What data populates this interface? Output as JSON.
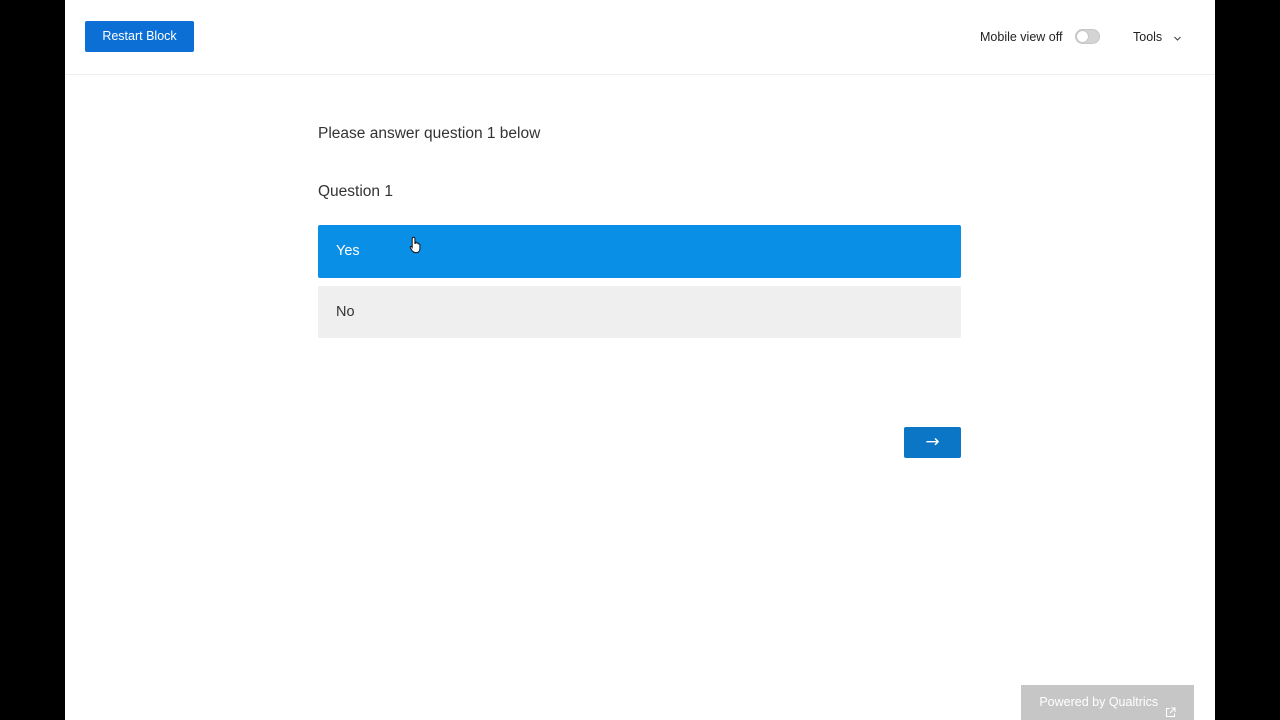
{
  "toolbar": {
    "restart_label": "Restart Block",
    "mobile_view_label": "Mobile view off",
    "mobile_view_on": false,
    "tools_label": "Tools",
    "tools_icon": "chevron-down-icon"
  },
  "survey": {
    "intro": "Please answer question 1 below",
    "question": "Question 1",
    "choices": [
      {
        "label": "Yes",
        "selected": true
      },
      {
        "label": "No",
        "selected": false
      }
    ],
    "next_label": "→"
  },
  "footer": {
    "powered_label": "Powered by Qualtrics",
    "powered_icon": "external-link-icon"
  },
  "colors": {
    "primary_button": "#0b6fd6",
    "selected_choice": "#0a8fe6",
    "unselected_choice": "#efefef",
    "next_button": "#0b76c6",
    "footer_badge": "#c6c6c6"
  }
}
